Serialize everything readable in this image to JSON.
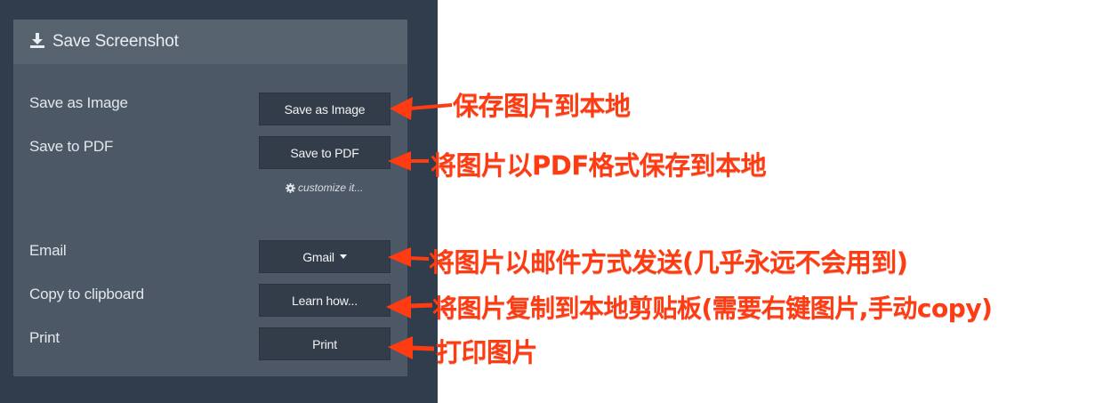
{
  "panel": {
    "title": "Save Screenshot",
    "title_icon": "download-icon",
    "rows": [
      {
        "label": "Save as Image",
        "button": "Save as Image"
      },
      {
        "label": "Save to PDF",
        "button": "Save to PDF"
      },
      {
        "label": "Email",
        "button": "Gmail"
      },
      {
        "label": "Copy to clipboard",
        "button": "Learn how..."
      },
      {
        "label": "Print",
        "button": "Print"
      }
    ],
    "customize_link": "customize it...",
    "customize_icon": "gear-icon"
  },
  "annotations": [
    "保存图片到本地",
    "将图片以PDF格式保存到本地",
    "将图片以邮件方式发送(几乎永远不会用到)",
    "将图片复制到本地剪贴板(需要右键图片,手动copy)",
    "打印图片"
  ],
  "colors": {
    "background_dark": "#2f3d4c",
    "panel": "#4c5866",
    "panel_header": "#57626f",
    "button": "#333d49",
    "annotation": "#ff3b12"
  }
}
